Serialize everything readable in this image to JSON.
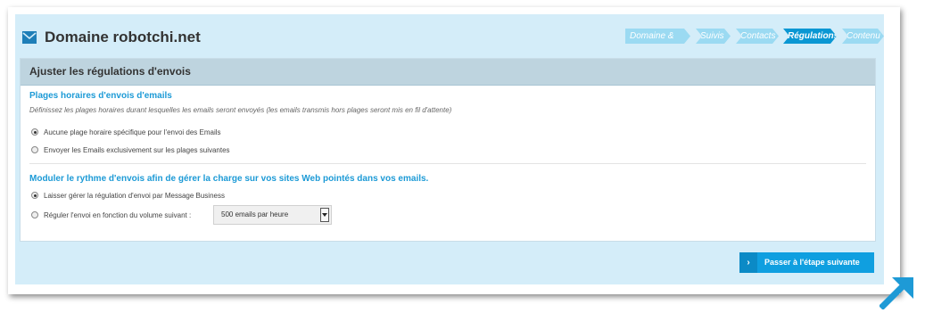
{
  "header": {
    "title": "Domaine robotchi.net",
    "icon": "envelope-icon"
  },
  "stepper": {
    "steps": [
      {
        "label": "Domaine & DNS",
        "active": false
      },
      {
        "label": "Suivis",
        "active": false
      },
      {
        "label": "Contacts",
        "active": false
      },
      {
        "label": "Régulations",
        "active": true
      },
      {
        "label": "Contenu",
        "active": false
      }
    ]
  },
  "card": {
    "title": "Ajuster les régulations d'envois",
    "section1": {
      "title": "Plages horaires d'envois d'emails",
      "description": "Définissez les plages horaires durant lesquelles les emails seront envoyés (les emails transmis hors plages seront mis en fil d'attente)",
      "options": [
        {
          "label": "Aucune plage horaire spécifique pour l'envoi des Emails",
          "selected": true
        },
        {
          "label": "Envoyer les Emails exclusivement sur les plages suivantes",
          "selected": false
        }
      ]
    },
    "section2": {
      "title": "Moduler le rythme d'envois afin de gérer la charge sur vos sites Web pointés dans vos emails.",
      "options": [
        {
          "label": "Laisser gérer la régulation d'envoi par Message Business",
          "selected": true
        },
        {
          "label": "Réguler l'envoi en fonction du volume suivant :",
          "selected": false
        }
      ],
      "volume_select": {
        "value": "500 emails par heure"
      }
    }
  },
  "next_button": {
    "label": "Passer à l'étape suivante",
    "icon": "chevron-right-icon"
  },
  "colors": {
    "accent": "#0f9fe0",
    "panel_bg": "#d4edf9",
    "step_inactive": "#9bdaf2",
    "step_active": "#0a97d3"
  }
}
